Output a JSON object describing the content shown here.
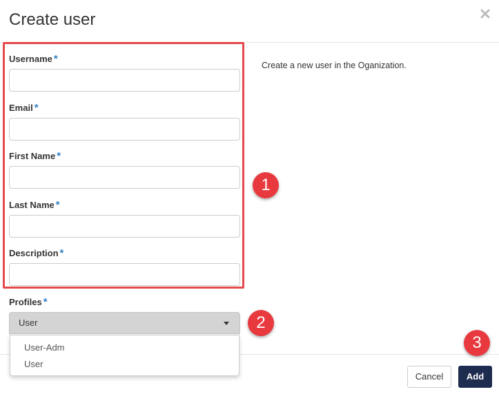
{
  "dialog": {
    "title": "Create user",
    "close_icon": "close-icon",
    "help_text": "Create a new user in the Oganization."
  },
  "form": {
    "required_marker": "*",
    "fields": [
      {
        "label": "Username",
        "value": ""
      },
      {
        "label": "Email",
        "value": ""
      },
      {
        "label": "First Name",
        "value": ""
      },
      {
        "label": "Last Name",
        "value": ""
      },
      {
        "label": "Description",
        "value": ""
      }
    ],
    "profiles": {
      "label": "Profiles",
      "selected": "User",
      "options": [
        "User-Adm",
        "User"
      ]
    }
  },
  "callouts": [
    "1",
    "2",
    "3"
  ],
  "footer": {
    "cancel_label": "Cancel",
    "add_label": "Add"
  },
  "colors": {
    "accent": "#2f7fc1",
    "highlight": "#e5484d",
    "badge": "#e8393f",
    "primary_button": "#1e2d4f"
  }
}
